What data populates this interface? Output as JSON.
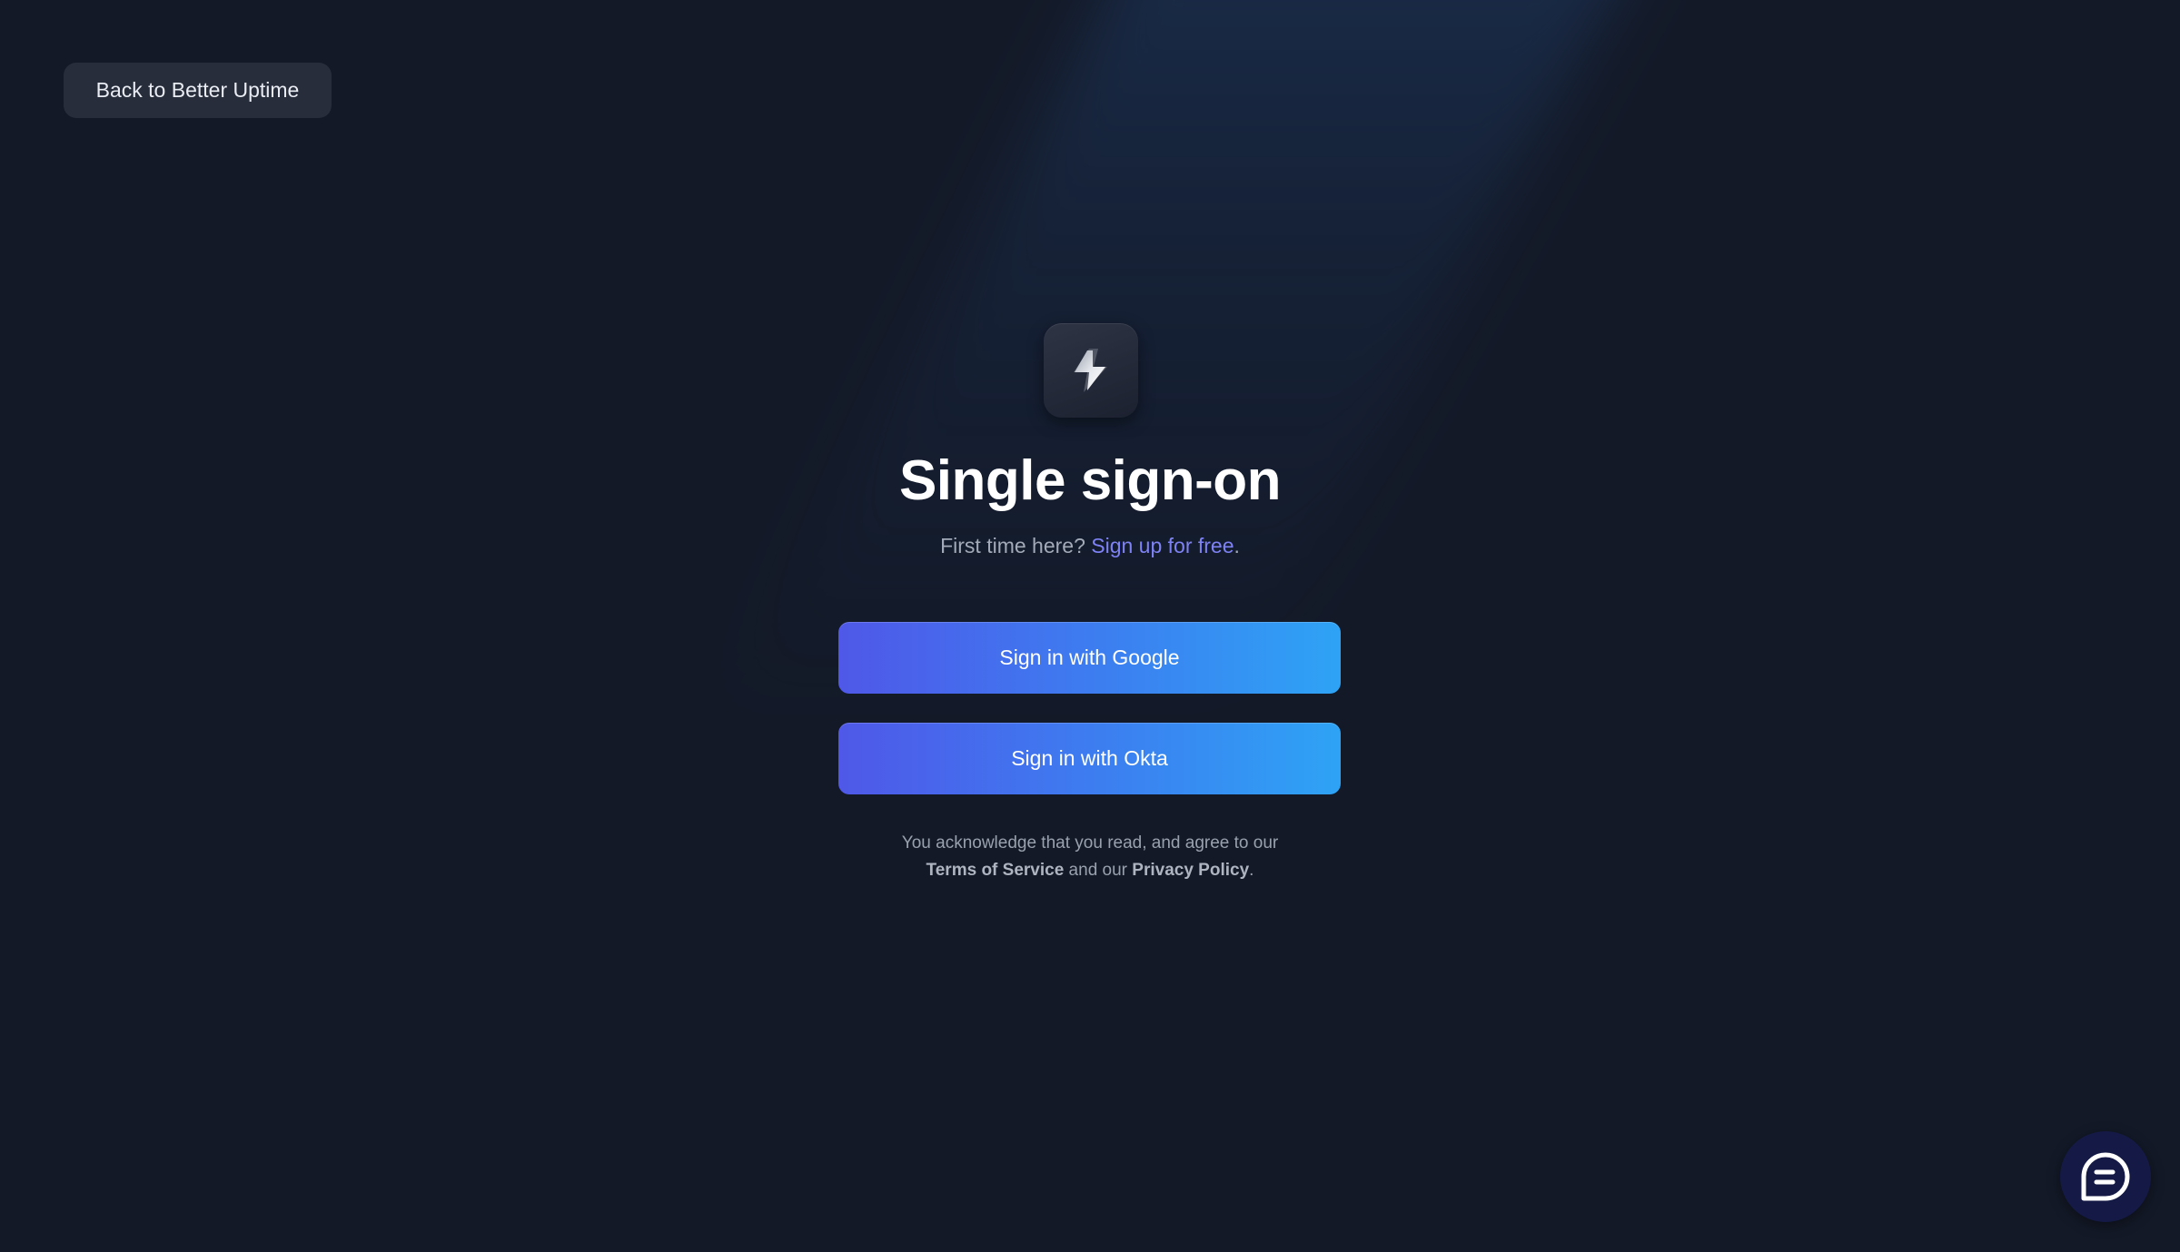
{
  "nav": {
    "back_label": "Back to Better Uptime"
  },
  "logo": {
    "icon": "lightning-bolt-icon"
  },
  "heading": {
    "title": "Single sign-on",
    "subtitle_prefix": "First time here? ",
    "signup_link": "Sign up for free",
    "subtitle_suffix": "."
  },
  "buttons": {
    "google_label": "Sign in with Google",
    "okta_label": "Sign in with Okta"
  },
  "legal": {
    "line1": "You acknowledge that you read, and agree to our",
    "terms_link": "Terms of Service",
    "middle": " and our ",
    "privacy_link": "Privacy Policy",
    "end": "."
  },
  "chat": {
    "icon": "chat-bubble-icon"
  },
  "colors": {
    "background": "#131927",
    "button_gradient_start": "#4f58e8",
    "button_gradient_end": "#2ea3f5",
    "link": "#7f82f5"
  }
}
